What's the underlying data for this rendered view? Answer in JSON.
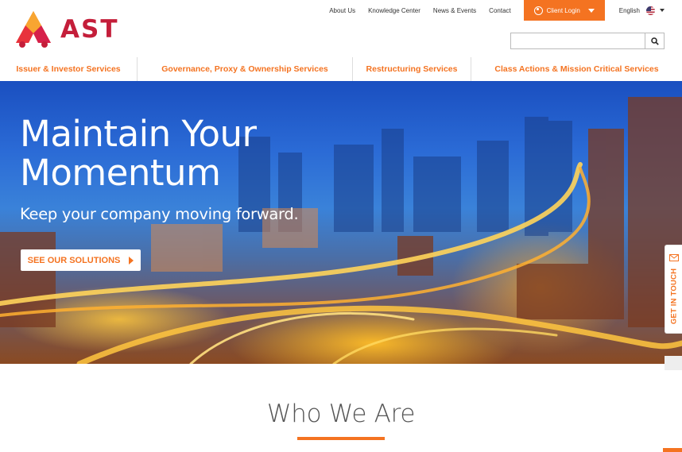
{
  "brand": {
    "name": "AST",
    "accent_color": "#f47321",
    "logo_color": "#c41e3a"
  },
  "topnav": {
    "links": [
      "About Us",
      "Knowledge Center",
      "News & Events",
      "Contact"
    ],
    "client_login": "Client Login",
    "language": "English",
    "flag_icon": "us-flag-icon"
  },
  "search": {
    "placeholder": "",
    "value": "",
    "icon": "search-icon"
  },
  "mainnav": {
    "items": [
      "Issuer & Investor Services",
      "Governance, Proxy & Ownership Services",
      "Restructuring Services",
      "Class Actions & Mission Critical Services"
    ]
  },
  "hero": {
    "title_line1": "Maintain Your",
    "title_line2": "Momentum",
    "subtitle": "Keep your company moving forward.",
    "cta": "SEE OUR SOLUTIONS"
  },
  "side_tab": {
    "label": "GET IN TOUCH",
    "icon": "envelope-icon"
  },
  "section": {
    "title": "Who We Are"
  }
}
